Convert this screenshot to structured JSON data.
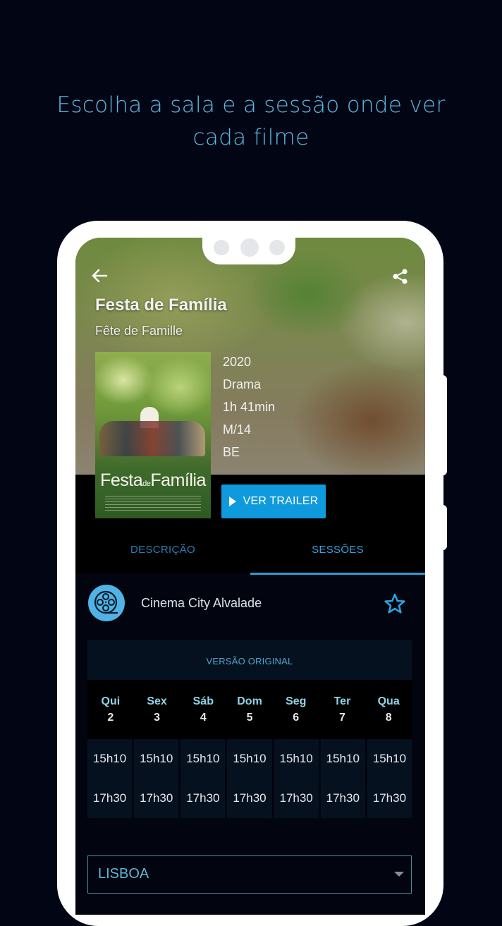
{
  "promo": {
    "headline_line1": "Escolha a sala e a sessão onde ver",
    "headline_line2": "cada filme"
  },
  "header": {
    "back_icon": "arrow-left-icon",
    "share_icon": "share-icon"
  },
  "movie": {
    "title": "Festa de Família",
    "original_title": "Fête de Famille",
    "poster_title_main": "Festa",
    "poster_title_de": "de",
    "poster_title_end": "Família",
    "year": "2020",
    "genre": "Drama",
    "duration": "1h 41min",
    "rating": "M/14",
    "country": "BE",
    "trailer_button": "VER TRAILER"
  },
  "tabs": [
    {
      "label": "DESCRIÇÃO",
      "active": false
    },
    {
      "label": "SESSÕES",
      "active": true
    }
  ],
  "cinema": {
    "name": "Cinema City Alvalade",
    "logo_icon": "film-reel-icon",
    "favorite_icon": "star-outline-icon"
  },
  "sessions": {
    "version": "VERSÃO ORIGINAL",
    "days": [
      {
        "name": "Qui",
        "date": "2",
        "times": [
          "15h10",
          "17h30"
        ]
      },
      {
        "name": "Sex",
        "date": "3",
        "times": [
          "15h10",
          "17h30"
        ]
      },
      {
        "name": "Sáb",
        "date": "4",
        "times": [
          "15h10",
          "17h30"
        ]
      },
      {
        "name": "Dom",
        "date": "5",
        "times": [
          "15h10",
          "17h30"
        ]
      },
      {
        "name": "Seg",
        "date": "6",
        "times": [
          "15h10",
          "17h30"
        ]
      },
      {
        "name": "Ter",
        "date": "7",
        "times": [
          "15h10",
          "17h30"
        ]
      },
      {
        "name": "Qua",
        "date": "8",
        "times": [
          "15h10",
          "17h30"
        ]
      }
    ]
  },
  "region_select": {
    "value": "LISBOA"
  },
  "colors": {
    "background": "#020614",
    "accent": "#0f9ade",
    "headline": "#5bb8e0",
    "day_name": "#8fd3e8"
  }
}
